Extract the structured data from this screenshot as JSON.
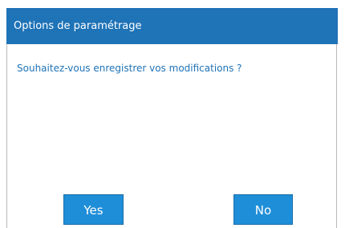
{
  "dialog": {
    "title": "Options de paramétrage",
    "message": "Souhaitez-vous enregistrer vos modifications ?",
    "yes_label": "Yes",
    "no_label": "No"
  },
  "colors": {
    "title_bar": "#1f73b7",
    "message_text": "#1f73b7",
    "button": "#1f8ed8"
  }
}
